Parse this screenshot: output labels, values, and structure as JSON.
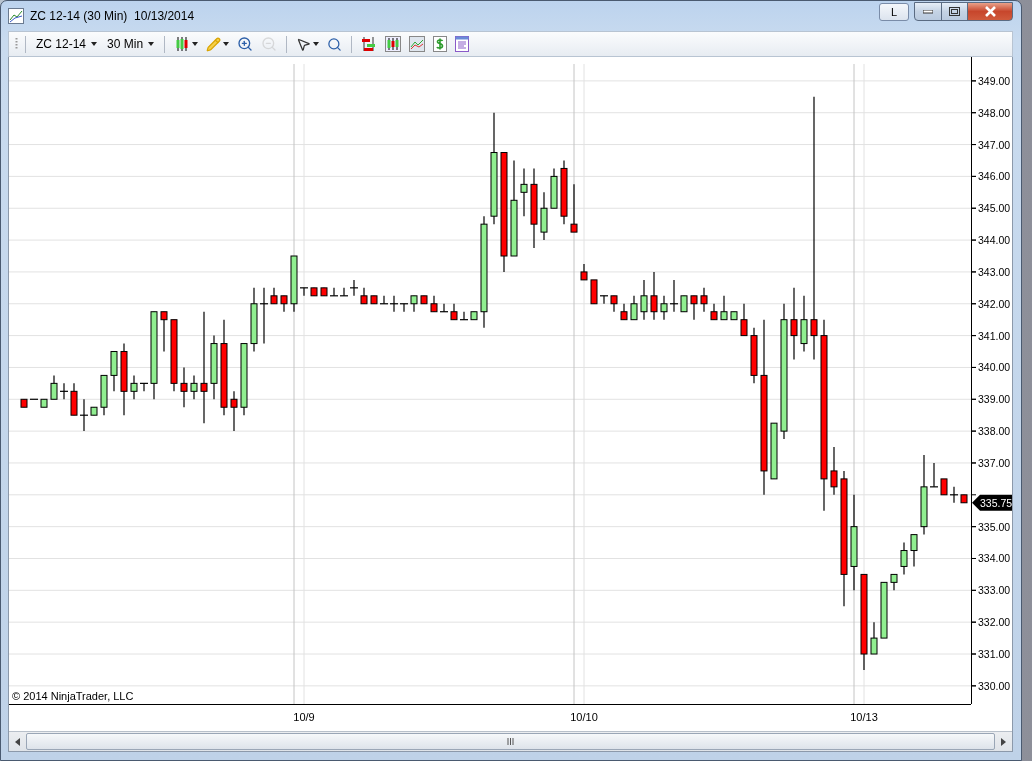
{
  "window": {
    "title": "ZC 12-14 (30 Min)  10/13/2014",
    "link_button": "L"
  },
  "toolbar": {
    "instrument": "ZC 12-14",
    "interval": "30 Min",
    "tool_groups": [
      [
        {
          "kind": "chart-style",
          "dropdown": true,
          "disabled": false
        },
        {
          "kind": "drawing",
          "dropdown": true,
          "disabled": false
        },
        {
          "kind": "zoom-in",
          "dropdown": false,
          "disabled": false
        },
        {
          "kind": "zoom-out",
          "dropdown": false,
          "disabled": true
        }
      ],
      [
        {
          "kind": "pointer",
          "dropdown": true,
          "disabled": false
        },
        {
          "kind": "magnifier",
          "dropdown": false,
          "disabled": false
        }
      ],
      [
        {
          "kind": "bars",
          "dropdown": false,
          "disabled": false
        },
        {
          "kind": "candles",
          "dropdown": false,
          "disabled": false
        },
        {
          "kind": "line",
          "dropdown": false,
          "disabled": false
        },
        {
          "kind": "dollar",
          "dropdown": false,
          "disabled": false
        },
        {
          "kind": "panel",
          "dropdown": false,
          "disabled": false
        }
      ]
    ]
  },
  "chart": {
    "copyright": "© 2014 NinjaTrader, LLC",
    "chart_data": {
      "type": "candlestick",
      "grid": true,
      "ylim": [
        329.43,
        349.53
      ],
      "categories": [
        null,
        null,
        null,
        null,
        null,
        null,
        null,
        null,
        null,
        null,
        null,
        null,
        null,
        null,
        null,
        null,
        null,
        null,
        null,
        null,
        null,
        null,
        null,
        null,
        null,
        null,
        null,
        null,
        "10/9",
        null,
        null,
        null,
        null,
        null,
        null,
        null,
        null,
        null,
        null,
        null,
        null,
        null,
        null,
        null,
        null,
        null,
        null,
        null,
        null,
        null,
        null,
        null,
        null,
        null,
        null,
        null,
        "10/10",
        null,
        null,
        null,
        null,
        null,
        null,
        null,
        null,
        null,
        null,
        null,
        null,
        null,
        null,
        null,
        null,
        null,
        null,
        null,
        null,
        null,
        null,
        null,
        null,
        null,
        null,
        null,
        "10/13",
        null,
        null,
        null,
        null,
        null,
        null,
        null,
        null,
        null,
        null
      ],
      "yticks": [
        {
          "value": 330,
          "label": "330.00"
        },
        {
          "value": 331,
          "label": "331.00"
        },
        {
          "value": 332,
          "label": "332.00"
        },
        {
          "value": 333,
          "label": "333.00"
        },
        {
          "value": 334,
          "label": "334.00"
        },
        {
          "value": 335,
          "label": "335.00"
        },
        {
          "value": 337,
          "label": "337.00"
        },
        {
          "value": 338,
          "label": "338.00"
        },
        {
          "value": 339,
          "label": "339.00"
        },
        {
          "value": 340,
          "label": "340.00"
        },
        {
          "value": 341,
          "label": "341.00"
        },
        {
          "value": 342,
          "label": "342.00"
        },
        {
          "value": 343,
          "label": "343.00"
        },
        {
          "value": 344,
          "label": "344.00"
        },
        {
          "value": 345,
          "label": "345.00"
        },
        {
          "value": 346,
          "label": "346.00"
        },
        {
          "value": 347,
          "label": "347.00"
        },
        {
          "value": 348,
          "label": "348.00"
        },
        {
          "value": 349,
          "label": "349.00"
        }
      ],
      "ohlc": [
        [
          339,
          339,
          338.75,
          338.75
        ],
        [
          339,
          339,
          339,
          339
        ],
        [
          338.75,
          339,
          338.75,
          339
        ],
        [
          339,
          339.75,
          339,
          339.5
        ],
        [
          339.25,
          339.5,
          339,
          339.25
        ],
        [
          339.25,
          339.5,
          338.5,
          338.5
        ],
        [
          338.5,
          339,
          338,
          338.5
        ],
        [
          338.5,
          338.75,
          338.5,
          338.75
        ],
        [
          338.75,
          339.75,
          338.5,
          339.75
        ],
        [
          339.75,
          340.5,
          339.25,
          340.5
        ],
        [
          340.5,
          340.75,
          338.5,
          339.25
        ],
        [
          339.25,
          339.75,
          339,
          339.5
        ],
        [
          339.5,
          339.5,
          339.25,
          339.5
        ],
        [
          339.5,
          341.75,
          339,
          341.75
        ],
        [
          341.75,
          341.75,
          340.5,
          341.5
        ],
        [
          341.5,
          341.5,
          339.25,
          339.5
        ],
        [
          339.5,
          340,
          338.75,
          339.25
        ],
        [
          339.25,
          339.75,
          339,
          339.5
        ],
        [
          339.5,
          341.75,
          338.25,
          339.25
        ],
        [
          339.5,
          341,
          339,
          340.75
        ],
        [
          340.75,
          341.5,
          338.5,
          338.75
        ],
        [
          339,
          339.25,
          338,
          338.75
        ],
        [
          338.75,
          340.75,
          338.5,
          340.75
        ],
        [
          340.75,
          342.5,
          340.5,
          342
        ],
        [
          342,
          342.5,
          340.75,
          342
        ],
        [
          342.25,
          342.5,
          342,
          342
        ],
        [
          342.25,
          342.25,
          341.75,
          342
        ],
        [
          342,
          343.5,
          341.75,
          343.5
        ],
        [
          342.5,
          342.5,
          342.25,
          342.5
        ],
        [
          342.5,
          342.5,
          342.25,
          342.25
        ],
        [
          342.5,
          342.5,
          342.25,
          342.25
        ],
        [
          342.25,
          342.5,
          342.25,
          342.25
        ],
        [
          342.25,
          342.5,
          342.25,
          342.25
        ],
        [
          342.5,
          342.75,
          342.25,
          342.5
        ],
        [
          342.25,
          342.5,
          342,
          342
        ],
        [
          342.25,
          342.25,
          342,
          342
        ],
        [
          342,
          342.25,
          342,
          342
        ],
        [
          342,
          342.25,
          341.75,
          342
        ],
        [
          342,
          342,
          341.75,
          342
        ],
        [
          342,
          342.25,
          341.75,
          342.25
        ],
        [
          342.25,
          342.25,
          342,
          342
        ],
        [
          342,
          342.25,
          341.75,
          341.75
        ],
        [
          341.75,
          342,
          341.75,
          341.75
        ],
        [
          341.75,
          342,
          341.5,
          341.5
        ],
        [
          341.5,
          341.75,
          341.5,
          341.5
        ],
        [
          341.5,
          341.75,
          341.5,
          341.75
        ],
        [
          341.75,
          344.75,
          341.25,
          344.5
        ],
        [
          344.75,
          348,
          344.5,
          346.75
        ],
        [
          346.75,
          346.75,
          343,
          343.5
        ],
        [
          343.5,
          346.5,
          343.5,
          345.25
        ],
        [
          345.5,
          346.25,
          344.75,
          345.75
        ],
        [
          345.75,
          346.25,
          343.75,
          344.5
        ],
        [
          344.25,
          345.5,
          344,
          345
        ],
        [
          345,
          346.25,
          345,
          346
        ],
        [
          346.25,
          346.5,
          344.5,
          344.75
        ],
        [
          344.5,
          345.75,
          344.25,
          344.25
        ],
        [
          343,
          343.25,
          342.75,
          342.75
        ],
        [
          342.75,
          342.75,
          342,
          342
        ],
        [
          342.25,
          342.25,
          342,
          342.25
        ],
        [
          342.25,
          342.25,
          341.75,
          342
        ],
        [
          341.75,
          342,
          341.5,
          341.5
        ],
        [
          341.5,
          342.25,
          341.5,
          342
        ],
        [
          341.75,
          342.75,
          341.5,
          342.25
        ],
        [
          342.25,
          343,
          341.5,
          341.75
        ],
        [
          341.75,
          342.25,
          341.5,
          342
        ],
        [
          342,
          342.75,
          341.75,
          342
        ],
        [
          341.75,
          342.25,
          341.75,
          342.25
        ],
        [
          342.25,
          342.25,
          341.5,
          342
        ],
        [
          342.25,
          342.5,
          341.75,
          342
        ],
        [
          341.75,
          342,
          341.5,
          341.5
        ],
        [
          341.5,
          342.25,
          341.5,
          341.75
        ],
        [
          341.5,
          341.75,
          341.5,
          341.75
        ],
        [
          341.5,
          342,
          341,
          341
        ],
        [
          341,
          341.25,
          339.5,
          339.75
        ],
        [
          339.75,
          341.5,
          336,
          336.75
        ],
        [
          336.5,
          338.25,
          336.5,
          338.25
        ],
        [
          338,
          342,
          337.75,
          341.5
        ],
        [
          341.5,
          342.5,
          340.25,
          341
        ],
        [
          340.75,
          342.25,
          340.5,
          341.5
        ],
        [
          341.5,
          348.5,
          340.25,
          341
        ],
        [
          341,
          341.5,
          335.5,
          336.5
        ],
        [
          336.75,
          337.5,
          336,
          336.25
        ],
        [
          336.5,
          336.75,
          332.5,
          333.5
        ],
        [
          333.75,
          336,
          333,
          335
        ],
        [
          333.5,
          333.5,
          330.5,
          331
        ],
        [
          331,
          332,
          331,
          331.5
        ],
        [
          331.5,
          333.25,
          331.5,
          333.25
        ],
        [
          333.25,
          333.5,
          333,
          333.5
        ],
        [
          333.75,
          334.5,
          333.5,
          334.25
        ],
        [
          334.25,
          334.75,
          333.75,
          334.75
        ],
        [
          335,
          337.25,
          334.75,
          336.25
        ],
        [
          336.25,
          337,
          336.25,
          336.25
        ],
        [
          336.5,
          336.5,
          336,
          336
        ],
        [
          336,
          336.25,
          335.75,
          336
        ],
        [
          336,
          336,
          335.75,
          335.75
        ]
      ],
      "annotations": [
        "335.75"
      ]
    }
  }
}
